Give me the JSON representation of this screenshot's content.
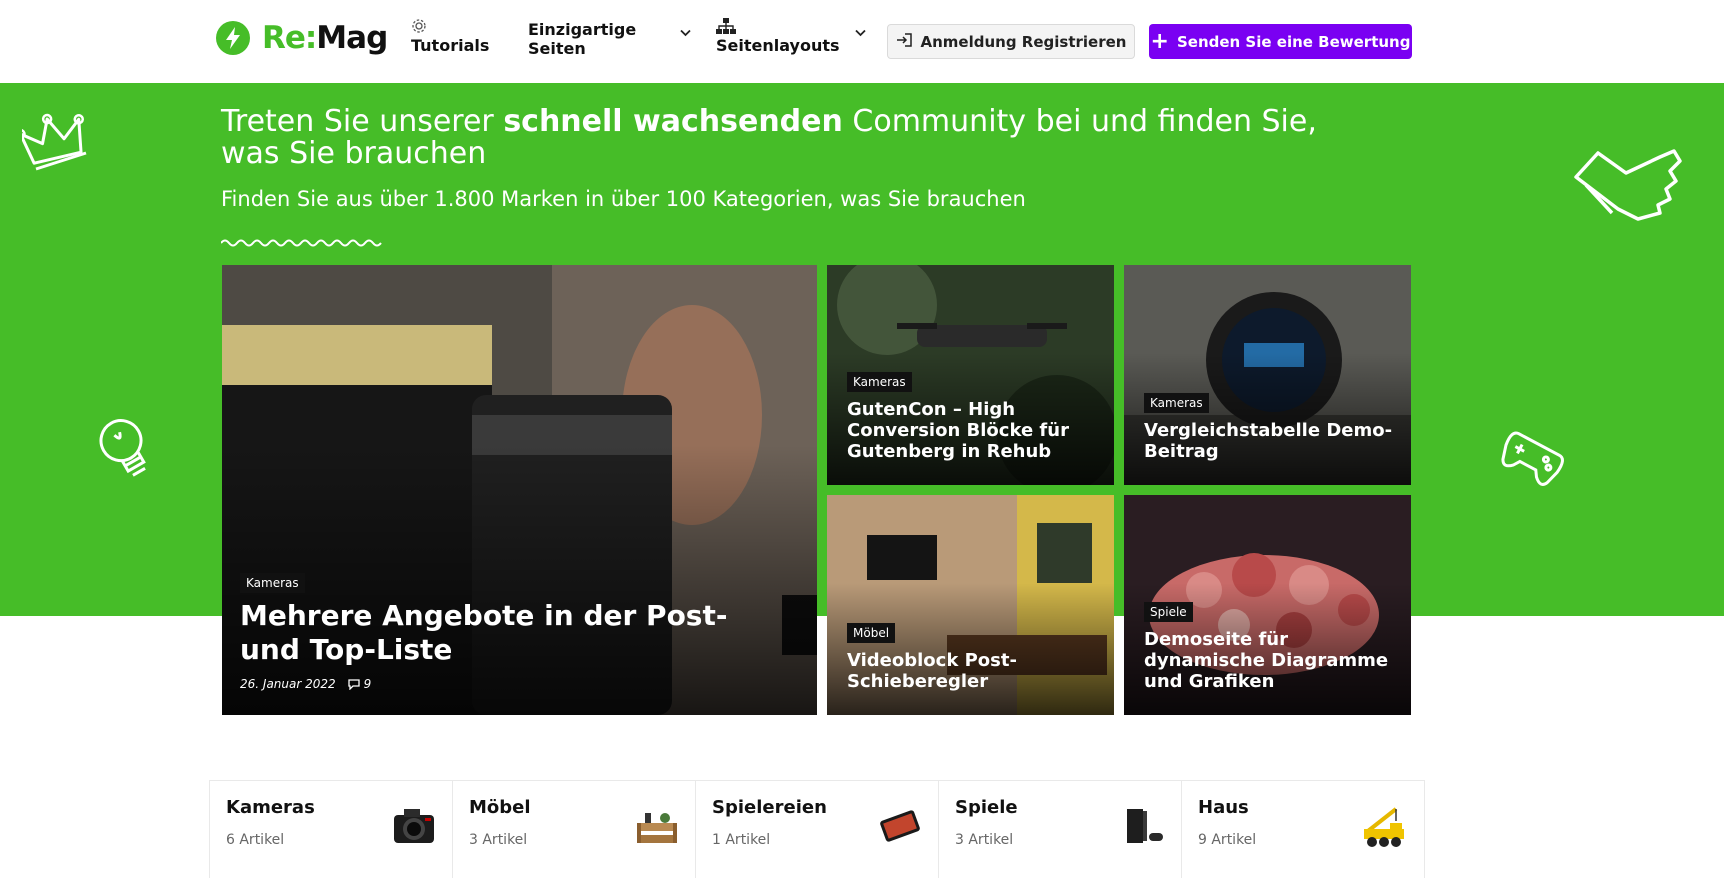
{
  "header": {
    "logo": {
      "prefix": "Re:",
      "suffix": "Mag"
    },
    "nav": [
      {
        "label": "Tutorials",
        "icon": "gear-icon"
      },
      {
        "label_line1": "Einzigartige",
        "label_line2": "Seiten",
        "icon": "chevron-down-icon"
      },
      {
        "label": "Seitenlayouts",
        "icon": "sitemap-icon"
      }
    ],
    "login_button": "Anmeldung Registrieren",
    "review_button": "Senden Sie eine Bewertung"
  },
  "hero": {
    "title_pre": "Treten Sie unserer ",
    "title_bold": "schnell wachsenden",
    "title_post": " Community bei und finden Sie, was Sie brauchen",
    "subtitle": "Finden Sie aus über 1.800 Marken in über 100 Kategorien, was Sie brauchen"
  },
  "posts": [
    {
      "category": "Kameras",
      "title": "Mehrere Angebote in der Post- und Top-Liste",
      "date": "26. Januar 2022",
      "comments": "9"
    },
    {
      "category": "Kameras",
      "title": "GutenCon – High Conversion Blöcke für Gutenberg in Rehub"
    },
    {
      "category": "Kameras",
      "title": "Vergleichstabelle Demo-Beitrag"
    },
    {
      "category": "Möbel",
      "title": "Videoblock Post-Schieberegler"
    },
    {
      "category": "Spiele",
      "title": "Demoseite für dynamische Diagramme und Grafiken"
    }
  ],
  "categories": [
    {
      "name": "Kameras",
      "count": "6 Artikel",
      "icon": "camera-icon"
    },
    {
      "name": "Möbel",
      "count": "3 Artikel",
      "icon": "furniture-icon"
    },
    {
      "name": "Spielereien",
      "count": "1 Artikel",
      "icon": "tablet-icon"
    },
    {
      "name": "Spiele",
      "count": "3 Artikel",
      "icon": "game-console-icon"
    },
    {
      "name": "Haus",
      "count": "9 Artikel",
      "icon": "crane-truck-icon"
    }
  ],
  "colors": {
    "brand_green": "#46bd28",
    "accent_purple": "#7a00f2"
  }
}
